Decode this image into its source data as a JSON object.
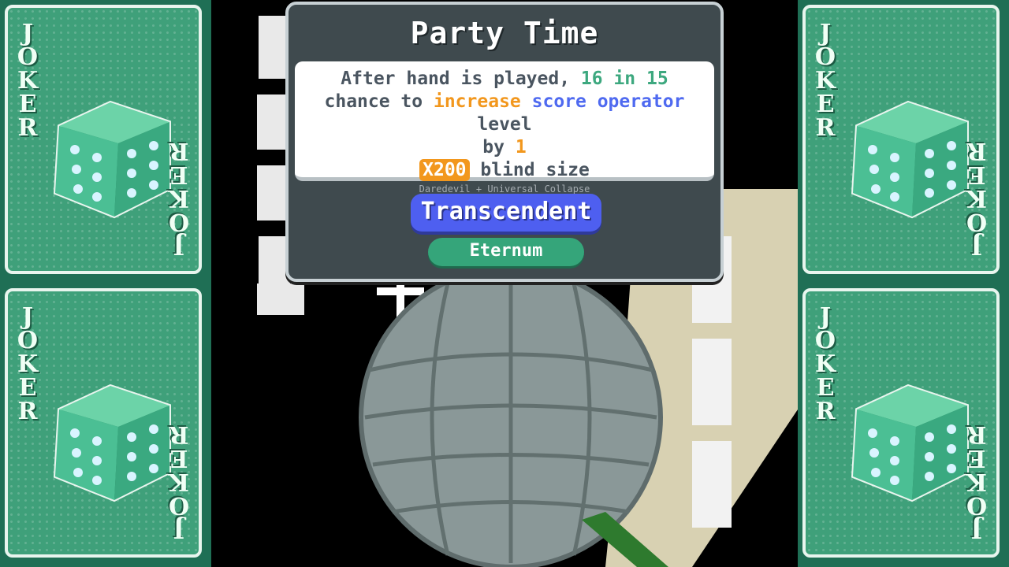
{
  "tooltip": {
    "title": "Party Time",
    "desc": {
      "line1_pre": "After hand is played, ",
      "line1_odds": "16 in 15",
      "line2_pre": "chance to ",
      "line2_increase": "increase",
      "line2_space": " ",
      "line2_score": "score operator",
      "line2_post": " level",
      "line3_pre": "by ",
      "line3_value": "1",
      "line4_badge": "X200",
      "line4_post": " blind size",
      "subtext": "Daredevil + Universal Collapse"
    },
    "rarity": "Transcendent",
    "edition": "Eternum"
  },
  "cards": {
    "label": "JOKER",
    "count": 4
  },
  "colors": {
    "card_green": "#3fa07a",
    "odds_green": "#3da87f",
    "orange": "#f2971d",
    "blue": "#4f6af0",
    "rarity_bg": "#4e5ff0",
    "edition_bg": "#35a57a",
    "tooltip_bg": "#3f4a4e"
  },
  "icons": {
    "card_art": "dice-icon",
    "center_art": "disco-ball-icon"
  }
}
